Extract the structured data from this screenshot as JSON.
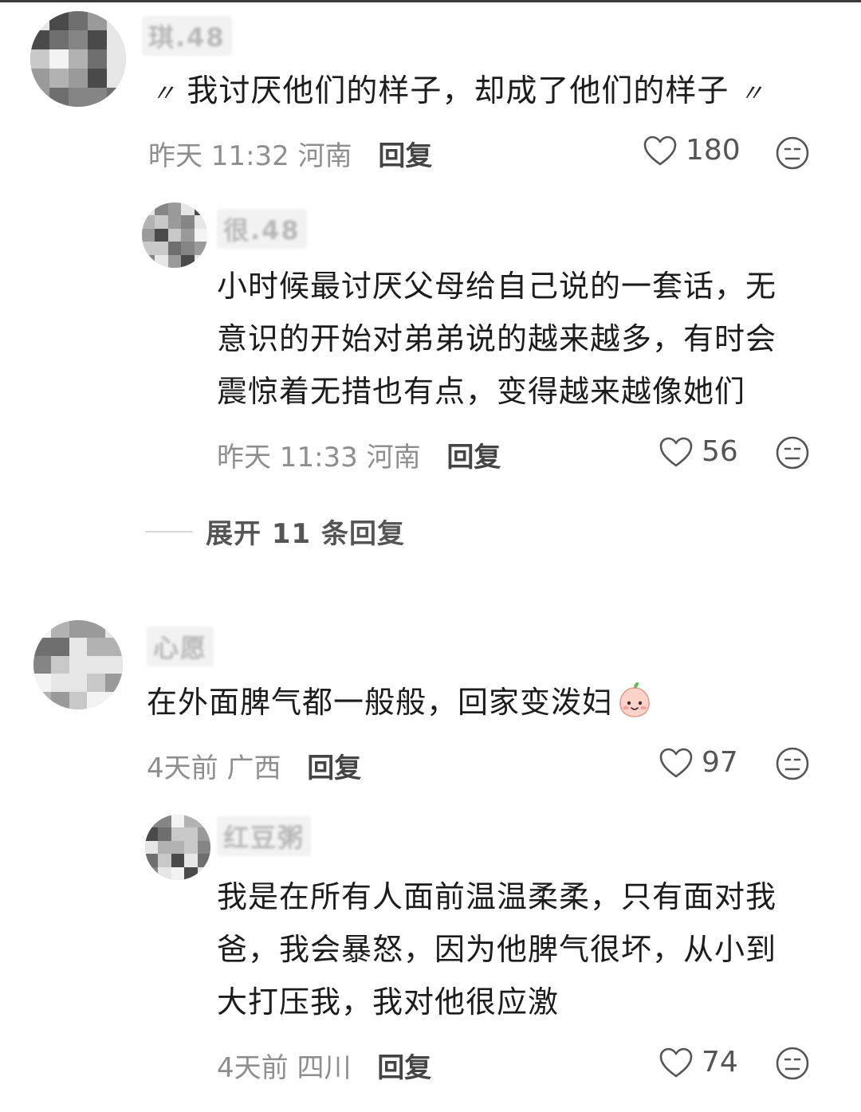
{
  "comments": [
    {
      "username": "琪.48",
      "text": "我讨厌他们的样子，却成了他们的样子",
      "quote_open": "〃",
      "quote_close": "〃",
      "time": "昨天 11:32",
      "location": "河南",
      "reply_label": "回复",
      "likes": "180",
      "replies": [
        {
          "username": "很.48",
          "text_lines": [
            "小时候最讨厌父母给自己说的一套话，无",
            "意识的开始对弟弟说的越来越多，有时会",
            "震惊着无措也有点，变得越来越像她们"
          ],
          "time": "昨天 11:33",
          "location": "河南",
          "reply_label": "回复",
          "likes": "56"
        }
      ],
      "expand_label": "展开 11 条回复"
    },
    {
      "username": "心愿",
      "text": "在外面脾气都一般般，回家变泼妇",
      "emoji": "peach-face-emoji",
      "time": "4天前",
      "location": "广西",
      "reply_label": "回复",
      "likes": "97",
      "replies": [
        {
          "username": "红豆粥",
          "text_lines": [
            "我是在所有人面前温温柔柔，只有面对我",
            "爸，我会暴怒，因为他脾气很坏，从小到",
            "大打压我，我对他很应激"
          ],
          "time": "4天前",
          "location": "四川",
          "reply_label": "回复",
          "likes": "74"
        }
      ]
    }
  ],
  "colors": {
    "meta_gray": "#8e8e8e",
    "text": "#1c1c1c",
    "reply": "#444444"
  }
}
